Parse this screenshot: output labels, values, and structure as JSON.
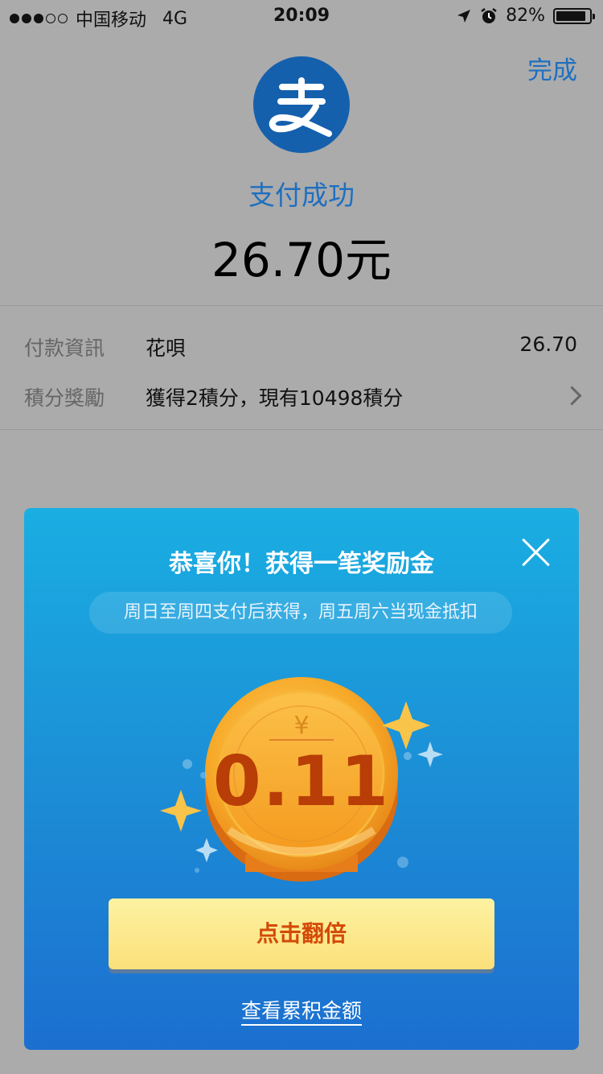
{
  "status_bar": {
    "carrier": "中国移动",
    "network": "4G",
    "time": "20:09",
    "battery": "82%",
    "battery_level": 0.82,
    "signal_strength": 3,
    "signal_max": 5
  },
  "header": {
    "done_label": "完成",
    "logo_glyph": "支",
    "success_title": "支付成功",
    "amount": "26.70元"
  },
  "info": {
    "rows": [
      {
        "label": "付款資訊",
        "value": "花唄",
        "right": "26.70"
      },
      {
        "label": "積分獎勵",
        "value": "獲得2積分，現有10498積分",
        "right": ""
      }
    ]
  },
  "modal": {
    "title": "恭喜你！获得一笔奖励金",
    "subtitle": "周日至周四支付后获得，周五周六当现金抵扣",
    "coin_currency": "¥",
    "coin_value": "0.11",
    "double_button_label": "点击翻倍",
    "view_link_label": "查看累积金额"
  },
  "colors": {
    "accent": "#1f6fc0",
    "logo_bg": "#1560ad",
    "modal_top": "#1aaee2",
    "modal_bottom": "#1c6fd0",
    "button_text": "#d34a08",
    "coin_text": "#b83d06"
  }
}
